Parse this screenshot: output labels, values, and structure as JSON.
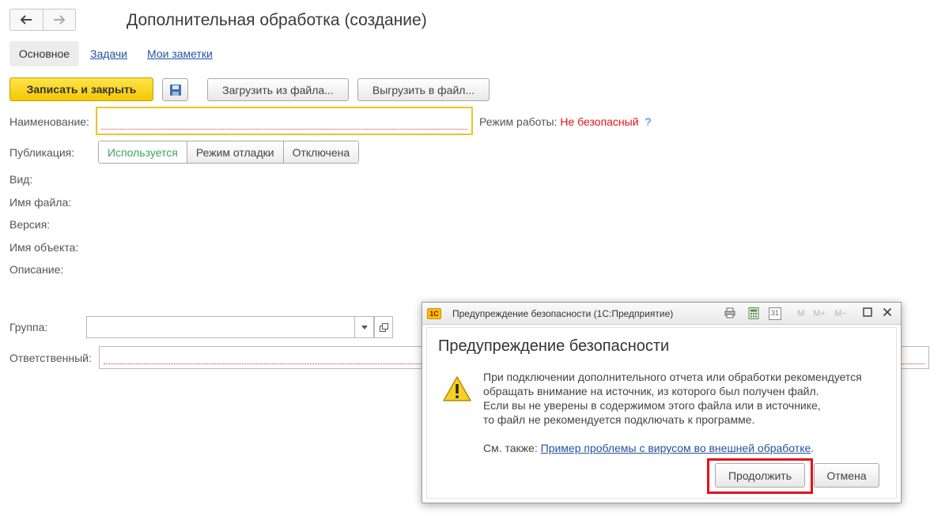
{
  "window": {
    "title": "Дополнительная обработка (создание)"
  },
  "tabs": [
    {
      "label": "Основное",
      "active": true
    },
    {
      "label": "Задачи"
    },
    {
      "label": "Мои заметки"
    }
  ],
  "toolbar": {
    "save_close": "Записать и закрыть",
    "load_file": "Загрузить из файла...",
    "export_file": "Выгрузить в файл..."
  },
  "form": {
    "name_label": "Наименование:",
    "name_value": "",
    "mode_label": "Режим работы:",
    "mode_value": "Не безопасный",
    "help": "?",
    "publication_label": "Публикация:",
    "publication_options": [
      "Используется",
      "Режим отладки",
      "Отключена"
    ],
    "publication_selected": "Используется",
    "kind_label": "Вид:",
    "filename_label": "Имя файла:",
    "version_label": "Версия:",
    "object_label": "Имя объекта:",
    "description_label": "Описание:",
    "group_label": "Группа:",
    "group_value": "",
    "responsible_label": "Ответственный:",
    "responsible_value": ""
  },
  "dialog": {
    "window_title": "Предупреждение безопасности  (1С:Предприятие)",
    "logo": "1С",
    "heading": "Предупреждение безопасности",
    "text_lines": [
      "При подключении дополнительного отчета или обработки рекомендуется",
      "обращать внимание на источник, из которого был получен файл.",
      "Если вы не уверены в содержимом этого файла или в источнике,",
      "то файл не рекомендуется подключать к программе."
    ],
    "see_also_label": "См. также:",
    "see_also_link": "Пример проблемы с вирусом во внешней обработке",
    "see_also_end": ".",
    "continue_button": "Продолжить",
    "cancel_button": "Отмена",
    "toolbar_icons": [
      "print-icon",
      "calculator-icon",
      "calendar-icon",
      "memory-icon",
      "memory-plus-icon",
      "memory-minus-icon",
      "maximize-icon",
      "close-icon"
    ],
    "toolbar_labels": {
      "calendar": "31",
      "m": "M",
      "m_plus": "M+",
      "m_minus": "M−"
    }
  },
  "colors": {
    "accent_yellow": "#f4c800",
    "danger": "#e3121b",
    "link": "#2552a0",
    "active_option": "#3fa55a"
  }
}
